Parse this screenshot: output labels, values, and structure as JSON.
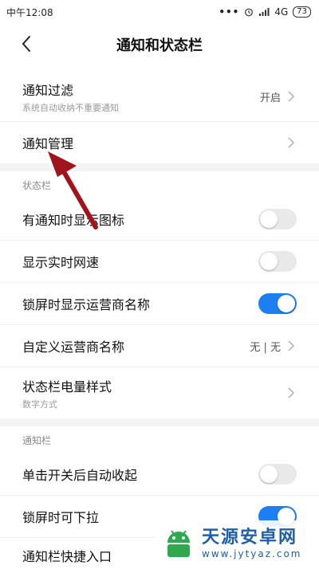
{
  "status_bar": {
    "time": "中午12:08",
    "dots": "•••",
    "network": "4G",
    "battery": "73"
  },
  "header": {
    "title": "通知和状态栏"
  },
  "items": [
    {
      "label": "通知过滤",
      "sub": "系统自动收纳不重要通知",
      "value": "开启"
    },
    {
      "label": "通知管理"
    }
  ],
  "status_section": {
    "title": "状态栏",
    "items": [
      {
        "label": "有通知时显示图标",
        "toggle": false
      },
      {
        "label": "显示实时网速",
        "toggle": false
      },
      {
        "label": "锁屏时显示运营商名称",
        "toggle": true
      },
      {
        "label": "自定义运营商名称",
        "value": "无 | 无"
      },
      {
        "label": "状态栏电量样式",
        "sub": "数字方式"
      }
    ]
  },
  "notify_section": {
    "title": "通知栏",
    "items": [
      {
        "label": "单击开关后自动收起",
        "toggle": false
      },
      {
        "label": "锁屏时可下拉",
        "toggle": true
      },
      {
        "label": "通知栏快捷入口"
      }
    ]
  },
  "watermark": {
    "title": "天源安卓网",
    "url": "www.jytyaz.com"
  },
  "colors": {
    "accent": "#1e7ff0",
    "arrow": "#a0141c"
  }
}
